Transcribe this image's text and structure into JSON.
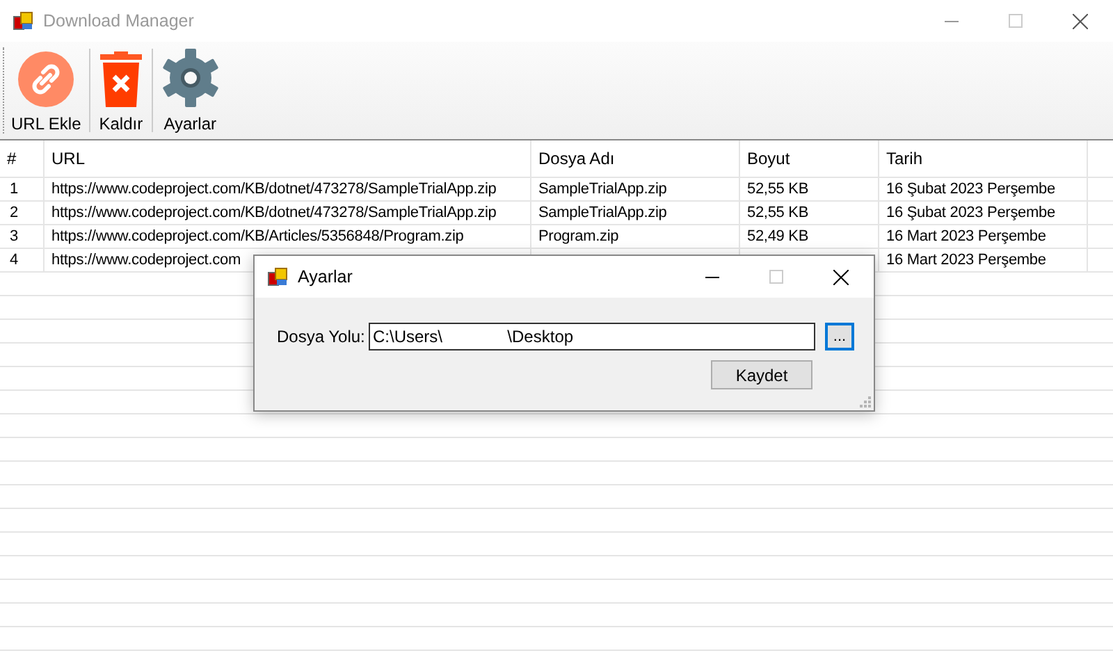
{
  "window": {
    "title": "Download Manager",
    "active": false
  },
  "toolbar": [
    {
      "kind": "link",
      "label": "URL Ekle"
    },
    {
      "kind": "delete",
      "label": "Kaldır"
    },
    {
      "kind": "gear",
      "label": "Ayarlar"
    }
  ],
  "table": {
    "columns": [
      "#",
      "URL",
      "Dosya Adı",
      "Boyut",
      "Tarih"
    ],
    "rows": [
      {
        "cells": [
          "1",
          "https://www.codeproject.com/KB/dotnet/473278/SampleTrialApp.zip",
          "SampleTrialApp.zip",
          "52,55 KB",
          "16 Şubat 2023 Perşembe"
        ]
      },
      {
        "cells": [
          "2",
          "https://www.codeproject.com/KB/dotnet/473278/SampleTrialApp.zip",
          "SampleTrialApp.zip",
          "52,55 KB",
          "16 Şubat 2023 Perşembe"
        ]
      },
      {
        "cells": [
          "3",
          "https://www.codeproject.com/KB/Articles/5356848/Program.zip",
          "Program.zip",
          "52,49 KB",
          "16 Mart 2023 Perşembe"
        ]
      },
      {
        "cells": [
          "4",
          "https://www.codeproject.com",
          null,
          null,
          "16 Mart 2023 Perşembe"
        ]
      }
    ]
  },
  "dialog": {
    "title": "Ayarlar",
    "label": "Dosya Yolu:",
    "path": "C:\\Users\\              \\Desktop",
    "browse_button": "...",
    "save_button": "Kaydet"
  }
}
